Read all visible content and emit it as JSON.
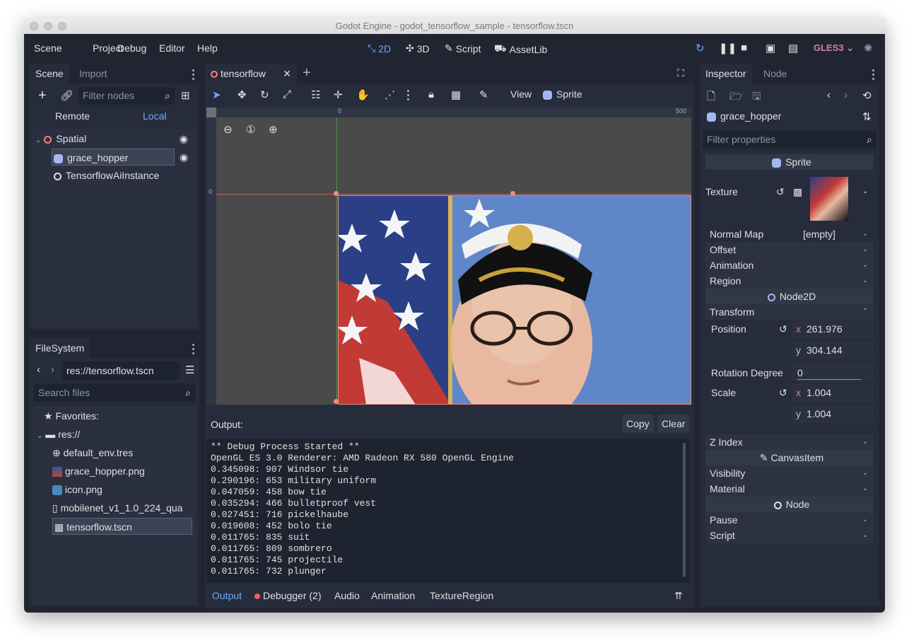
{
  "window": {
    "title": "Godot Engine - godot_tensorflow_sample - tensorflow.tscn"
  },
  "menubar": {
    "menus": [
      "Scene",
      "Project",
      "Debug",
      "Editor",
      "Help"
    ],
    "workspaces": [
      "2D",
      "3D",
      "Script",
      "AssetLib"
    ],
    "renderer": "GLES3"
  },
  "scene_dock": {
    "tabs": [
      "Scene",
      "Import"
    ],
    "filter_placeholder": "Filter nodes",
    "remote_label": "Remote",
    "local_label": "Local",
    "tree": [
      {
        "label": "Spatial"
      },
      {
        "label": "grace_hopper"
      },
      {
        "label": "TensorflowAiInstance"
      }
    ]
  },
  "filesystem_dock": {
    "tab": "FileSystem",
    "path": "res://tensorflow.tscn",
    "search_placeholder": "Search files",
    "favorites": "Favorites:",
    "root": "res://",
    "files": [
      "default_env.tres",
      "grace_hopper.png",
      "icon.png",
      "mobilenet_v1_1.0_224_qua",
      "tensorflow.tscn"
    ]
  },
  "editor": {
    "tab": "tensorflow",
    "toolbar": {
      "view_label": "View",
      "sprite_label": "Sprite"
    },
    "ruler": {
      "zero": "0",
      "five_hundred": "500",
      "v_zero": "0"
    }
  },
  "output": {
    "label": "Output:",
    "copy_label": "Copy",
    "clear_label": "Clear",
    "lines": [
      "** Debug Process Started **",
      "OpenGL ES 3.0 Renderer: AMD Radeon RX 580 OpenGL Engine",
      "0.345098: 907 Windsor tie",
      "0.290196: 653 military uniform",
      "0.047059: 458 bow tie",
      "0.035294: 466 bulletproof vest",
      "0.027451: 716 pickelhaube",
      "0.019608: 452 bolo tie",
      "0.011765: 835 suit",
      "0.011765: 809 sombrero",
      "0.011765: 745 projectile",
      "0.011765: 732 plunger"
    ],
    "bottom_tabs": [
      "Output",
      "Debugger (2)",
      "Audio",
      "Animation",
      "TextureRegion"
    ]
  },
  "inspector": {
    "tabs": [
      "Inspector",
      "Node"
    ],
    "node_name": "grace_hopper",
    "filter_placeholder": "Filter properties",
    "sprite_section": "Sprite",
    "texture_label": "Texture",
    "normal_map_label": "Normal Map",
    "normal_map_value": "[empty]",
    "offset": "Offset",
    "animation": "Animation",
    "region": "Region",
    "node2d_section": "Node2D",
    "transform": "Transform",
    "position_label": "Position",
    "position_x": "261.976",
    "position_y": "304.144",
    "rotation_label": "Rotation Degree",
    "rotation_value": "0",
    "scale_label": "Scale",
    "scale_x": "1.004",
    "scale_y": "1.004",
    "x_axis": "x",
    "y_axis": "y",
    "z_index": "Z Index",
    "canvas_section": "CanvasItem",
    "visibility": "Visibility",
    "material": "Material",
    "node_section": "Node",
    "pause": "Pause",
    "script": "Script"
  },
  "colors": {
    "accent": "#6fa8ff",
    "renderer": "#d77ca6",
    "bg": "#202531",
    "panel": "#262c3b"
  }
}
